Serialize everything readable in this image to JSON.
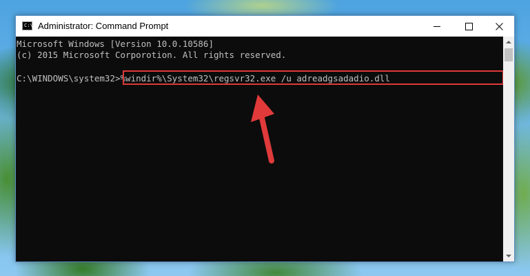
{
  "window": {
    "title": "Administrator: Command Prompt",
    "app_icon_glyph": "C:\\",
    "buttons": {
      "minimize_icon": "minimize-icon",
      "maximize_icon": "maximize-icon",
      "close_icon": "close-icon"
    }
  },
  "console": {
    "line1": "Microsoft Windows [Version 10.0.10586]",
    "line2": "(c) 2015 Microsoft Corporotion. All rights reserved.",
    "prompt": "C:\\WINDOWS\\system32>",
    "command": "%windir%\\System32\\regsvr32.exe /u adreadgsadadio.dll"
  },
  "annotation": {
    "highlight_color": "#e03a3a",
    "arrow_color": "#e03a3a"
  },
  "colors": {
    "console_background": "#0c0c0c",
    "console_text": "#c0c0c0",
    "title_bar": "#ffffff"
  }
}
